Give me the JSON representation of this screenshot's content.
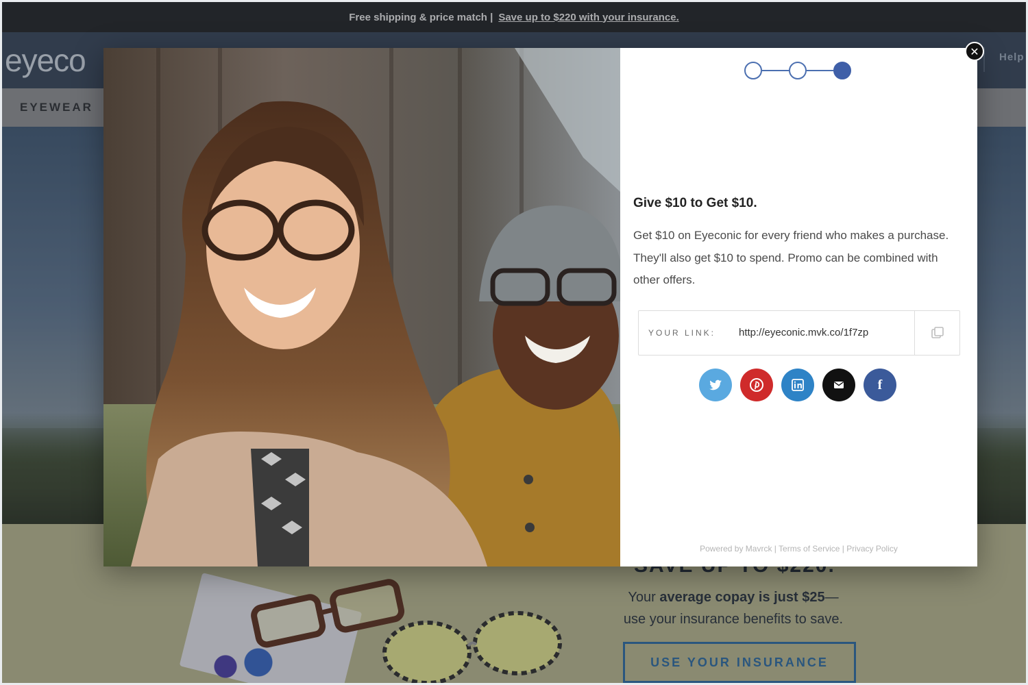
{
  "promo_bar": {
    "text": "Free shipping & price match |",
    "link": "Save up to $220 with your insurance."
  },
  "header": {
    "logo": "eyeco",
    "help": "Help"
  },
  "nav": {
    "eyewear": "EYEWEAR"
  },
  "insurance_section": {
    "headline": "SAVE UP TO $220.",
    "line1_prefix": "Your ",
    "line1_bold": "average copay is just $25",
    "line1_suffix": "—",
    "line2": "use your insurance benefits to save.",
    "button": "USE YOUR INSURANCE"
  },
  "modal": {
    "steps": [
      {
        "state": "complete"
      },
      {
        "state": "complete"
      },
      {
        "state": "active"
      }
    ],
    "heading": "Give $10 to Get $10.",
    "description": "Get $10 on Eyeconic for every friend who makes a purchase. They'll also get $10 to spend. Promo can be combined with other offers.",
    "link_label": "YOUR LINK:",
    "link_value": "http://eyeconic.mvk.co/1f7zp",
    "share_buttons": [
      {
        "network": "twitter",
        "icon": "twitter-icon",
        "color": "#5aa9e0"
      },
      {
        "network": "pinterest",
        "icon": "pinterest-icon",
        "color": "#cf2b2b"
      },
      {
        "network": "linkedin",
        "icon": "linkedin-icon",
        "color": "#2e83c6"
      },
      {
        "network": "email",
        "icon": "email-icon",
        "color": "#111111"
      },
      {
        "network": "facebook",
        "icon": "facebook-icon",
        "color": "#3b5a9a",
        "label": "f"
      }
    ],
    "footer": {
      "powered": "Powered by Mavrck",
      "sep": " | ",
      "terms": "Terms of Service",
      "privacy": "Privacy Policy"
    },
    "close_label": "✕"
  },
  "colors": {
    "accent": "#3f5fa8",
    "header_bg": "#354559",
    "promo_bg": "#1f2226",
    "insurance_button": "#2b6aa3"
  }
}
